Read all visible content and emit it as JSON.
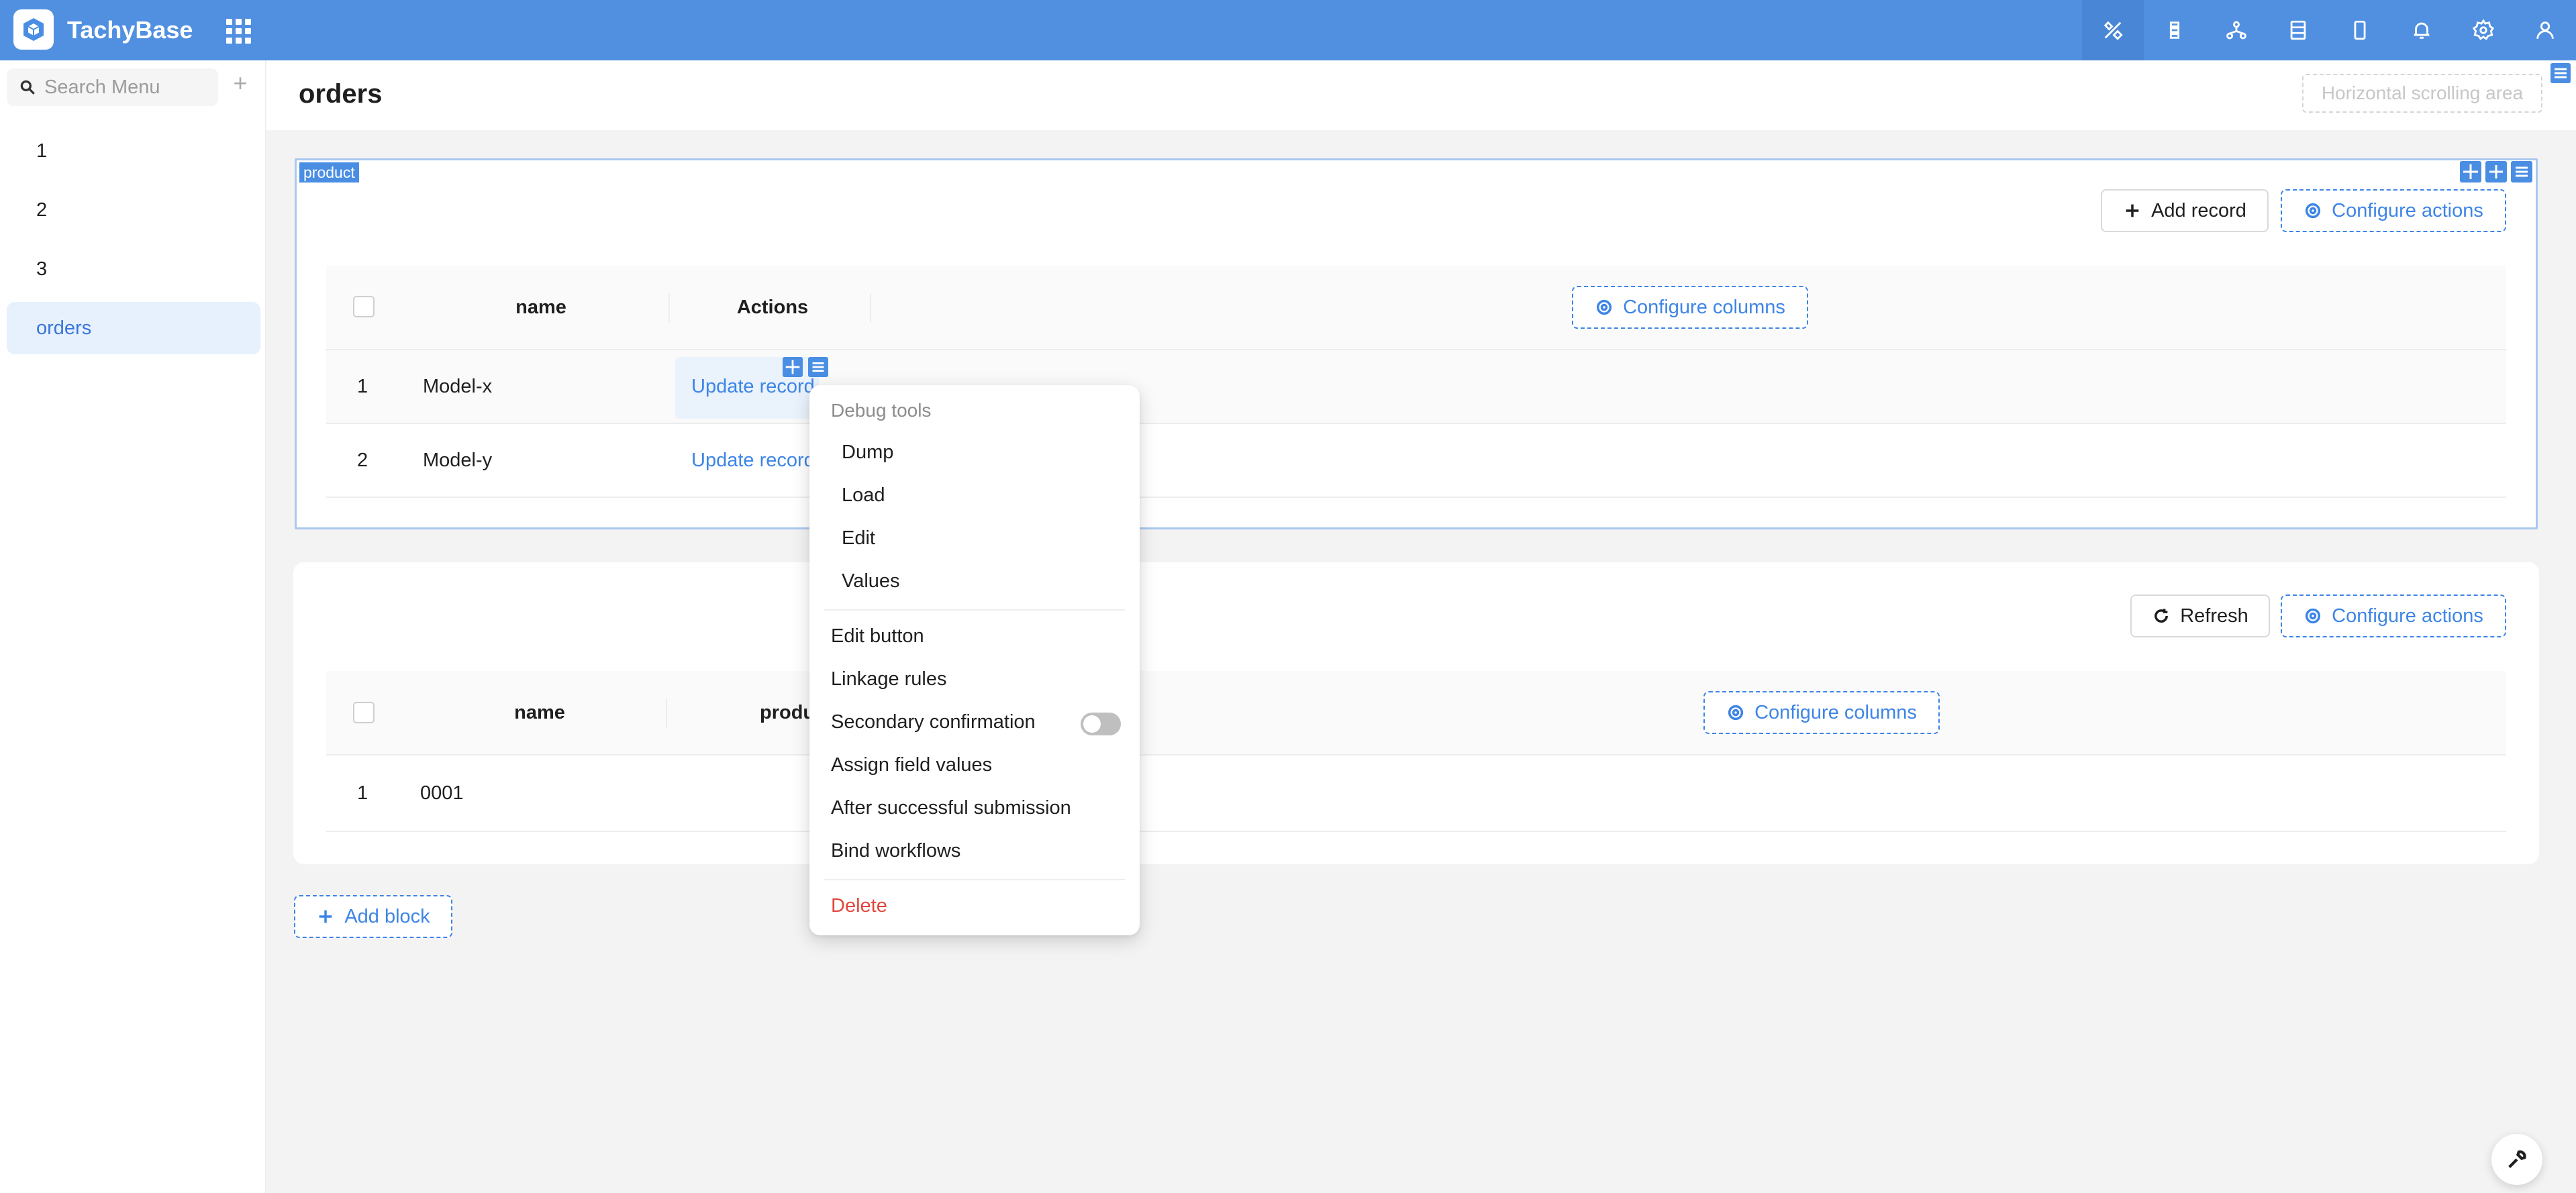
{
  "app": {
    "name": "TachyBase"
  },
  "sidebar": {
    "search_placeholder": "Search Menu",
    "add_symbol": "+",
    "items": [
      {
        "label": "1"
      },
      {
        "label": "2"
      },
      {
        "label": "3"
      },
      {
        "label": "orders",
        "active": true
      }
    ]
  },
  "page": {
    "title": "orders",
    "hscroll_label": "Horizontal scrolling area"
  },
  "block1": {
    "tag": "product",
    "add_record_label": "Add record",
    "configure_actions_label": "Configure actions",
    "columns": [
      "name",
      "Actions"
    ],
    "configure_columns_label": "Configure columns",
    "rows": [
      {
        "index": "1",
        "name": "Model-x",
        "action": "Update record"
      },
      {
        "index": "2",
        "name": "Model-y",
        "action": "Update record"
      }
    ]
  },
  "block2": {
    "refresh_label": "Refresh",
    "configure_actions_label": "Configure actions",
    "columns": [
      "name",
      "produ"
    ],
    "configure_columns_label": "Configure columns",
    "rows": [
      {
        "index": "1",
        "name": "0001"
      }
    ]
  },
  "add_block_label": "Add block",
  "dropdown": {
    "group_title": "Debug tools",
    "debug_items": [
      "Dump",
      "Load",
      "Edit",
      "Values"
    ],
    "items": [
      "Edit button",
      "Linkage rules",
      "Secondary confirmation",
      "Assign field values",
      "After successful submission",
      "Bind workflows"
    ],
    "secondary_confirmation_enabled": false,
    "delete_label": "Delete"
  },
  "colors": {
    "topbar": "#5190e0",
    "accent": "#3d85e6",
    "danger": "#e2463c"
  }
}
